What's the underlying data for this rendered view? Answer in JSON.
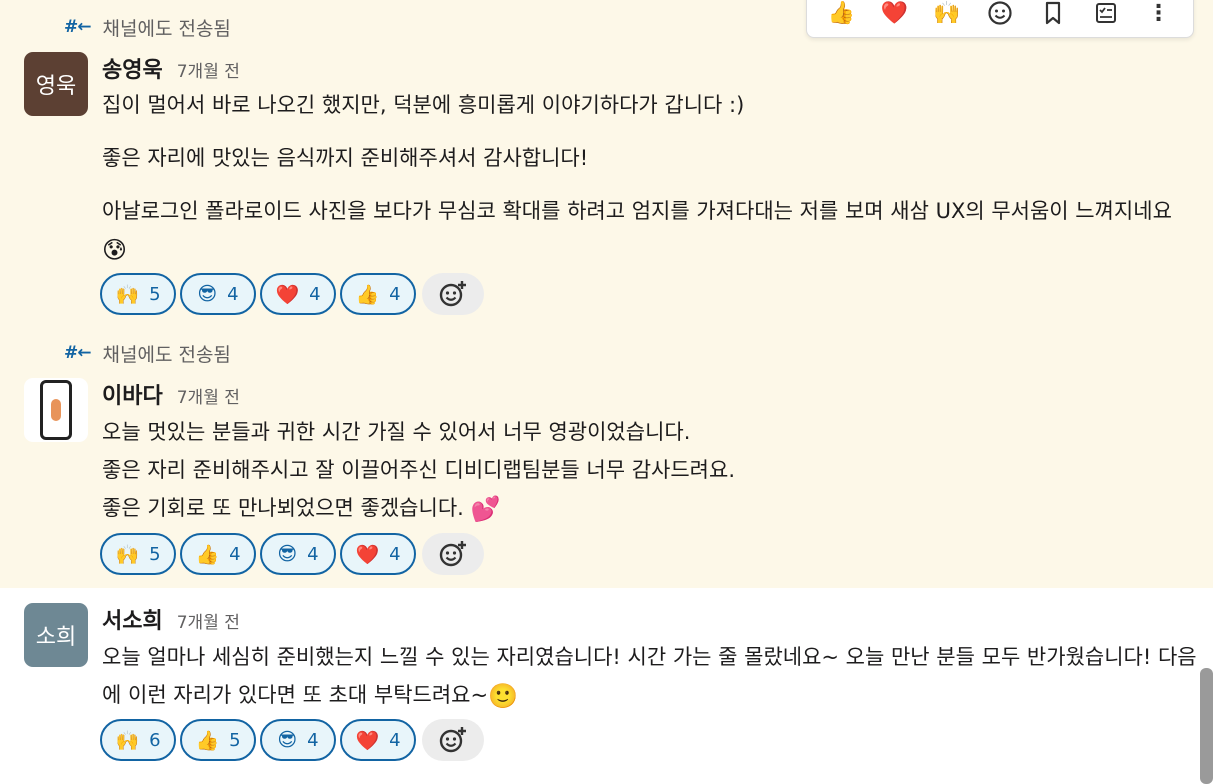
{
  "forward_label": "채널에도 전송됨",
  "toolbar": {
    "items": [
      {
        "name": "thumbsup",
        "glyph": "👍"
      },
      {
        "name": "heart",
        "glyph": "❤️"
      },
      {
        "name": "raised-hands",
        "glyph": "🙌"
      },
      {
        "name": "add-reaction",
        "glyph": "☺"
      },
      {
        "name": "bookmark",
        "glyph": "🔖"
      },
      {
        "name": "checklist",
        "glyph": "☑"
      },
      {
        "name": "more",
        "glyph": "⋮"
      }
    ]
  },
  "messages": [
    {
      "author": "송영욱",
      "avatar_text": "영욱",
      "avatar_color": "#5c4033",
      "time": "7개월 전",
      "forwarded": true,
      "paragraphs": [
        "집이 멀어서 바로 나오긴 했지만, 덕분에 흥미롭게 이야기하다가 갑니다 :)",
        "좋은 자리에 맛있는 음식까지 준비해주셔서 감사합니다!",
        "아날로그인 폴라로이드 사진을 보다가 무심코 확대를 하려고 엄지를 가져다대는 저를 보며 새삼 UX의 무서움이 느껴지네요"
      ],
      "trailing_emoji": "😰",
      "reactions": [
        {
          "emoji": "🙌",
          "count": "5"
        },
        {
          "emoji": "😎",
          "count": "4"
        },
        {
          "emoji": "❤️",
          "count": "4"
        },
        {
          "emoji": "👍",
          "count": "4"
        }
      ]
    },
    {
      "author": "이바다",
      "avatar_text": "",
      "avatar_color": "#ffffff",
      "time": "7개월 전",
      "forwarded": true,
      "lines": [
        "오늘 멋있는 분들과 귀한 시간 가질 수 있어서 너무 영광이었습니다.",
        "좋은 자리 준비해주시고 잘 이끌어주신 디비디랩팀분들 너무 감사드려요.",
        "좋은 기회로 또 만나뵈었으면 좋겠습니다."
      ],
      "trailing_emoji": "💕",
      "reactions": [
        {
          "emoji": "🙌",
          "count": "5"
        },
        {
          "emoji": "👍",
          "count": "4"
        },
        {
          "emoji": "😎",
          "count": "4"
        },
        {
          "emoji": "❤️",
          "count": "4"
        }
      ]
    },
    {
      "author": "서소희",
      "avatar_text": "소희",
      "avatar_color": "#6e8894",
      "time": "7개월 전",
      "forwarded": false,
      "text": "오늘 얼마나 세심히 준비했는지 느낄 수 있는 자리였습니다! 시간 가는 줄 몰랐네요~ 오늘 만난 분들 모두 반가웠습니다! 다음에 이런 자리가 있다면 또 초대 부탁드려요~",
      "trailing_emoji": "🙂",
      "reactions": [
        {
          "emoji": "🙌",
          "count": "6"
        },
        {
          "emoji": "👍",
          "count": "5"
        },
        {
          "emoji": "😎",
          "count": "4"
        },
        {
          "emoji": "❤️",
          "count": "4"
        }
      ]
    }
  ]
}
